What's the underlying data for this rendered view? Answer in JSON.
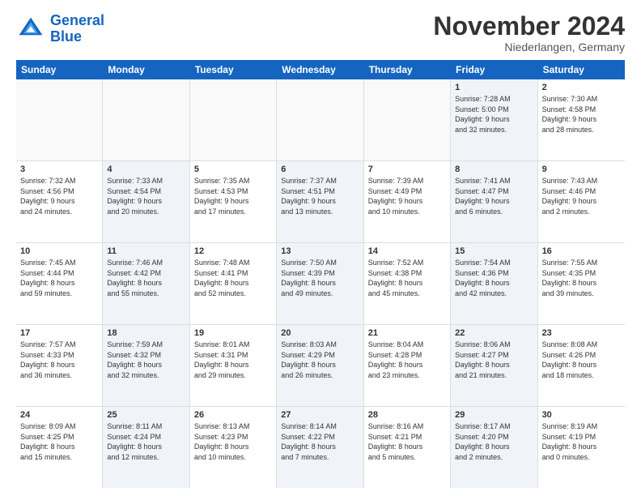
{
  "logo": {
    "line1": "General",
    "line2": "Blue"
  },
  "title": "November 2024",
  "location": "Niederlangen, Germany",
  "header_days": [
    "Sunday",
    "Monday",
    "Tuesday",
    "Wednesday",
    "Thursday",
    "Friday",
    "Saturday"
  ],
  "rows": [
    [
      {
        "day": "",
        "info": "",
        "empty": true
      },
      {
        "day": "",
        "info": "",
        "empty": true
      },
      {
        "day": "",
        "info": "",
        "empty": true
      },
      {
        "day": "",
        "info": "",
        "empty": true
      },
      {
        "day": "",
        "info": "",
        "empty": true
      },
      {
        "day": "1",
        "info": "Sunrise: 7:28 AM\nSunset: 5:00 PM\nDaylight: 9 hours\nand 32 minutes.",
        "shaded": true
      },
      {
        "day": "2",
        "info": "Sunrise: 7:30 AM\nSunset: 4:58 PM\nDaylight: 9 hours\nand 28 minutes.",
        "shaded": false
      }
    ],
    [
      {
        "day": "3",
        "info": "Sunrise: 7:32 AM\nSunset: 4:56 PM\nDaylight: 9 hours\nand 24 minutes.",
        "shaded": false
      },
      {
        "day": "4",
        "info": "Sunrise: 7:33 AM\nSunset: 4:54 PM\nDaylight: 9 hours\nand 20 minutes.",
        "shaded": true
      },
      {
        "day": "5",
        "info": "Sunrise: 7:35 AM\nSunset: 4:53 PM\nDaylight: 9 hours\nand 17 minutes.",
        "shaded": false
      },
      {
        "day": "6",
        "info": "Sunrise: 7:37 AM\nSunset: 4:51 PM\nDaylight: 9 hours\nand 13 minutes.",
        "shaded": true
      },
      {
        "day": "7",
        "info": "Sunrise: 7:39 AM\nSunset: 4:49 PM\nDaylight: 9 hours\nand 10 minutes.",
        "shaded": false
      },
      {
        "day": "8",
        "info": "Sunrise: 7:41 AM\nSunset: 4:47 PM\nDaylight: 9 hours\nand 6 minutes.",
        "shaded": true
      },
      {
        "day": "9",
        "info": "Sunrise: 7:43 AM\nSunset: 4:46 PM\nDaylight: 9 hours\nand 2 minutes.",
        "shaded": false
      }
    ],
    [
      {
        "day": "10",
        "info": "Sunrise: 7:45 AM\nSunset: 4:44 PM\nDaylight: 8 hours\nand 59 minutes.",
        "shaded": false
      },
      {
        "day": "11",
        "info": "Sunrise: 7:46 AM\nSunset: 4:42 PM\nDaylight: 8 hours\nand 55 minutes.",
        "shaded": true
      },
      {
        "day": "12",
        "info": "Sunrise: 7:48 AM\nSunset: 4:41 PM\nDaylight: 8 hours\nand 52 minutes.",
        "shaded": false
      },
      {
        "day": "13",
        "info": "Sunrise: 7:50 AM\nSunset: 4:39 PM\nDaylight: 8 hours\nand 49 minutes.",
        "shaded": true
      },
      {
        "day": "14",
        "info": "Sunrise: 7:52 AM\nSunset: 4:38 PM\nDaylight: 8 hours\nand 45 minutes.",
        "shaded": false
      },
      {
        "day": "15",
        "info": "Sunrise: 7:54 AM\nSunset: 4:36 PM\nDaylight: 8 hours\nand 42 minutes.",
        "shaded": true
      },
      {
        "day": "16",
        "info": "Sunrise: 7:55 AM\nSunset: 4:35 PM\nDaylight: 8 hours\nand 39 minutes.",
        "shaded": false
      }
    ],
    [
      {
        "day": "17",
        "info": "Sunrise: 7:57 AM\nSunset: 4:33 PM\nDaylight: 8 hours\nand 36 minutes.",
        "shaded": false
      },
      {
        "day": "18",
        "info": "Sunrise: 7:59 AM\nSunset: 4:32 PM\nDaylight: 8 hours\nand 32 minutes.",
        "shaded": true
      },
      {
        "day": "19",
        "info": "Sunrise: 8:01 AM\nSunset: 4:31 PM\nDaylight: 8 hours\nand 29 minutes.",
        "shaded": false
      },
      {
        "day": "20",
        "info": "Sunrise: 8:03 AM\nSunset: 4:29 PM\nDaylight: 8 hours\nand 26 minutes.",
        "shaded": true
      },
      {
        "day": "21",
        "info": "Sunrise: 8:04 AM\nSunset: 4:28 PM\nDaylight: 8 hours\nand 23 minutes.",
        "shaded": false
      },
      {
        "day": "22",
        "info": "Sunrise: 8:06 AM\nSunset: 4:27 PM\nDaylight: 8 hours\nand 21 minutes.",
        "shaded": true
      },
      {
        "day": "23",
        "info": "Sunrise: 8:08 AM\nSunset: 4:26 PM\nDaylight: 8 hours\nand 18 minutes.",
        "shaded": false
      }
    ],
    [
      {
        "day": "24",
        "info": "Sunrise: 8:09 AM\nSunset: 4:25 PM\nDaylight: 8 hours\nand 15 minutes.",
        "shaded": false
      },
      {
        "day": "25",
        "info": "Sunrise: 8:11 AM\nSunset: 4:24 PM\nDaylight: 8 hours\nand 12 minutes.",
        "shaded": true
      },
      {
        "day": "26",
        "info": "Sunrise: 8:13 AM\nSunset: 4:23 PM\nDaylight: 8 hours\nand 10 minutes.",
        "shaded": false
      },
      {
        "day": "27",
        "info": "Sunrise: 8:14 AM\nSunset: 4:22 PM\nDaylight: 8 hours\nand 7 minutes.",
        "shaded": true
      },
      {
        "day": "28",
        "info": "Sunrise: 8:16 AM\nSunset: 4:21 PM\nDaylight: 8 hours\nand 5 minutes.",
        "shaded": false
      },
      {
        "day": "29",
        "info": "Sunrise: 8:17 AM\nSunset: 4:20 PM\nDaylight: 8 hours\nand 2 minutes.",
        "shaded": true
      },
      {
        "day": "30",
        "info": "Sunrise: 8:19 AM\nSunset: 4:19 PM\nDaylight: 8 hours\nand 0 minutes.",
        "shaded": false
      }
    ]
  ]
}
